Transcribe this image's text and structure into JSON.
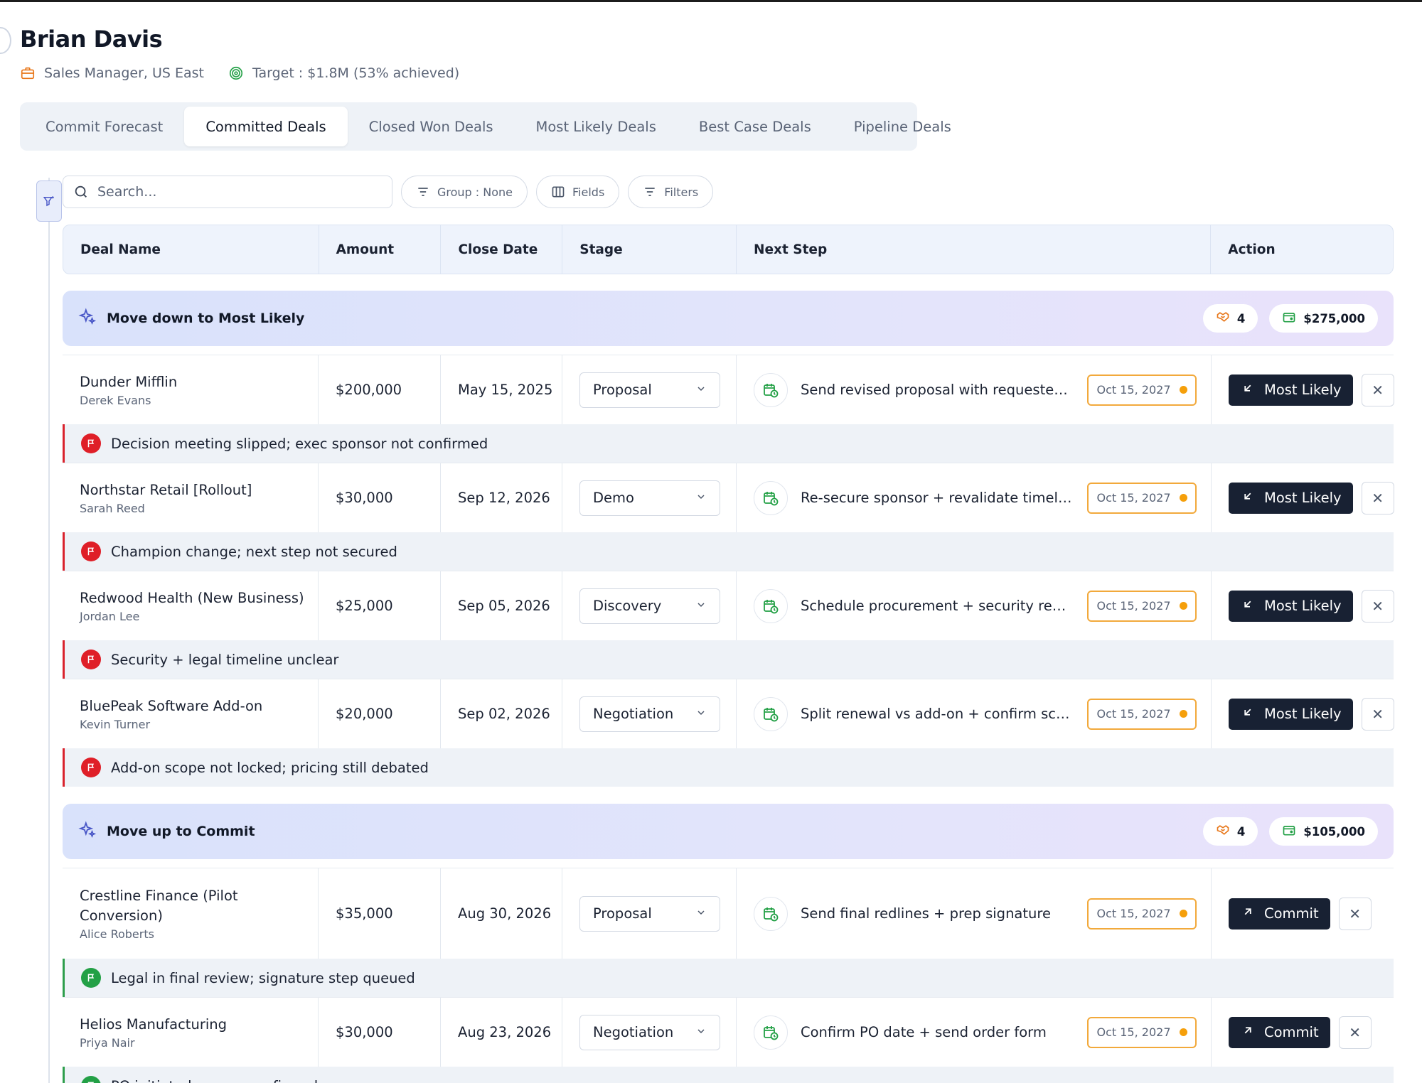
{
  "profile": {
    "name": "Brian Davis",
    "role": "Sales Manager, US East",
    "target": "Target : $1.8M (53% achieved)"
  },
  "tabs": [
    {
      "label": "Commit Forecast",
      "active": false
    },
    {
      "label": "Committed Deals",
      "active": true
    },
    {
      "label": "Closed Won Deals",
      "active": false
    },
    {
      "label": "Most Likely Deals",
      "active": false
    },
    {
      "label": "Best Case Deals",
      "active": false
    },
    {
      "label": "Pipeline Deals",
      "active": false
    }
  ],
  "toolbar": {
    "search_placeholder": "Search...",
    "group_label": "Group : None",
    "fields_label": "Fields",
    "filters_label": "Filters"
  },
  "columns": [
    "Deal Name",
    "Amount",
    "Close Date",
    "Stage",
    "Next Step",
    "Action"
  ],
  "groups": [
    {
      "title": "Move down to Most Likely",
      "count": "4",
      "total": "$275,000",
      "action_label": "Most Likely",
      "action_icon": "arrow-down-left-icon",
      "deals": [
        {
          "name": "Dunder Mifflin",
          "owner": "Derek Evans",
          "amount": "$200,000",
          "close_date": "May 15, 2025",
          "stage": "Proposal",
          "next_step": "Send revised proposal with requested adjustments",
          "next_date": "Oct 15, 2027",
          "note": "Decision meeting slipped; exec sponsor not confirmed",
          "note_status": "red"
        },
        {
          "name": "Northstar Retail [Rollout]",
          "owner": "Sarah Reed",
          "amount": "$30,000",
          "close_date": "Sep 12, 2026",
          "stage": "Demo",
          "next_step": "Re-secure sponsor + revalidate timeline",
          "next_date": "Oct 15, 2027",
          "note": "Champion change; next step not secured",
          "note_status": "red"
        },
        {
          "name": "Redwood Health (New Business)",
          "owner": "Jordan Lee",
          "amount": "$25,000",
          "close_date": "Sep 05, 2026",
          "stage": "Discovery",
          "next_step": "Schedule procurement + security review",
          "next_date": "Oct 15, 2027",
          "note": "Security + legal timeline unclear",
          "note_status": "red"
        },
        {
          "name": "BluePeak Software Add-on",
          "owner": "Kevin Turner",
          "amount": "$20,000",
          "close_date": "Sep 02, 2026",
          "stage": "Negotiation",
          "next_step": "Split renewal vs add-on + confirm scope",
          "next_date": "Oct 15, 2027",
          "note": "Add-on scope not locked; pricing still debated",
          "note_status": "red"
        }
      ]
    },
    {
      "title": "Move up to Commit",
      "count": "4",
      "total": "$105,000",
      "action_label": "Commit",
      "action_icon": "arrow-up-right-icon",
      "deals": [
        {
          "name": "Crestline Finance (Pilot Conversion)",
          "owner": "Alice Roberts",
          "amount": "$35,000",
          "close_date": "Aug 30, 2026",
          "stage": "Proposal",
          "next_step": "Send final redlines + prep signature",
          "next_date": "Oct 15, 2027",
          "note": "Legal in final review; signature step queued",
          "note_status": "green"
        },
        {
          "name": "Helios Manufacturing",
          "owner": "Priya Nair",
          "amount": "$30,000",
          "close_date": "Aug 23, 2026",
          "stage": "Negotiation",
          "next_step": "Confirm PO date + send order form",
          "next_date": "Oct 15, 2027",
          "note": "PO initiated; owner confirmed",
          "note_status": "green"
        }
      ]
    }
  ],
  "colors": {
    "accent_dark": "#182133",
    "warning": "#f59f0a",
    "risk": "#df1f28",
    "positive": "#23a046",
    "group_gradient_start": "#d9e2fb",
    "group_gradient_end": "#e9e2fb"
  }
}
